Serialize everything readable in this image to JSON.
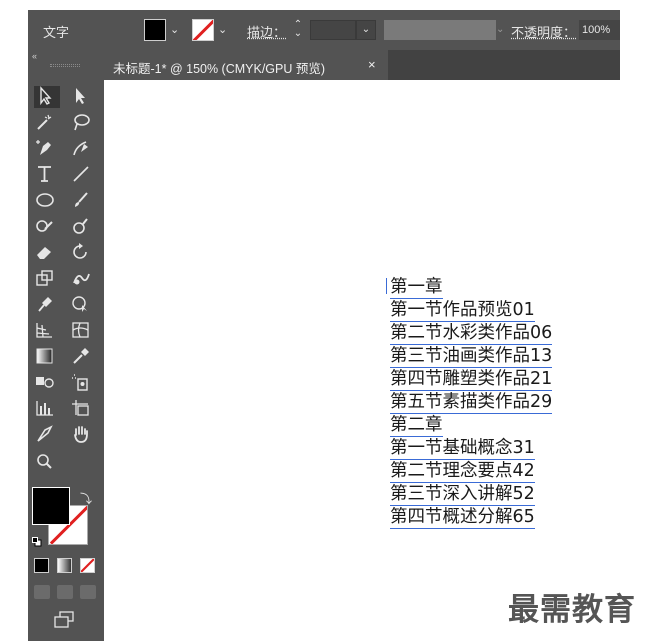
{
  "control_bar": {
    "tool_name": "文字",
    "stroke_label": "描边：",
    "opacity_label": "不透明度：",
    "opacity_value": "100%"
  },
  "document_tab": {
    "title": "未标题-1* @ 150% (CMYK/GPU 预览)",
    "close_glyph": "×"
  },
  "canvas_text": {
    "lines": [
      "第一章",
      "第一节作品预览01",
      "第二节水彩类作品06",
      "第三节油画类作品13",
      "第四节雕塑类作品21",
      "第五节素描类作品29",
      "第二章",
      "第一节基础概念31",
      "第二节理念要点42",
      "第三节深入讲解52",
      "第四节概述分解65"
    ]
  },
  "watermark": "最需教育",
  "colors": {
    "panel": "#535353",
    "fill": "#000000",
    "stroke_none": "#e02020",
    "text_underline": "#3a6bd6"
  },
  "tools": [
    "selection-tool-icon",
    "direct-selection-tool-icon",
    "magic-wand-tool-icon",
    "lasso-tool-icon",
    "pen-tool-icon",
    "curvature-tool-icon",
    "type-tool-icon",
    "line-segment-tool-icon",
    "ellipse-tool-icon",
    "paintbrush-tool-icon",
    "shaper-tool-icon",
    "blob-brush-tool-icon",
    "eraser-tool-icon",
    "rotate-tool-icon",
    "scale-tool-icon",
    "warp-tool-icon",
    "puppet-warp-tool-icon",
    "shape-builder-tool-icon",
    "perspective-grid-tool-icon",
    "mesh-tool-icon",
    "gradient-tool-icon",
    "eyedropper-tool-icon",
    "blend-tool-icon",
    "symbol-sprayer-tool-icon",
    "column-graph-tool-icon",
    "artboard-tool-icon",
    "slice-tool-icon",
    "hand-tool-icon",
    "zoom-tool-icon"
  ]
}
